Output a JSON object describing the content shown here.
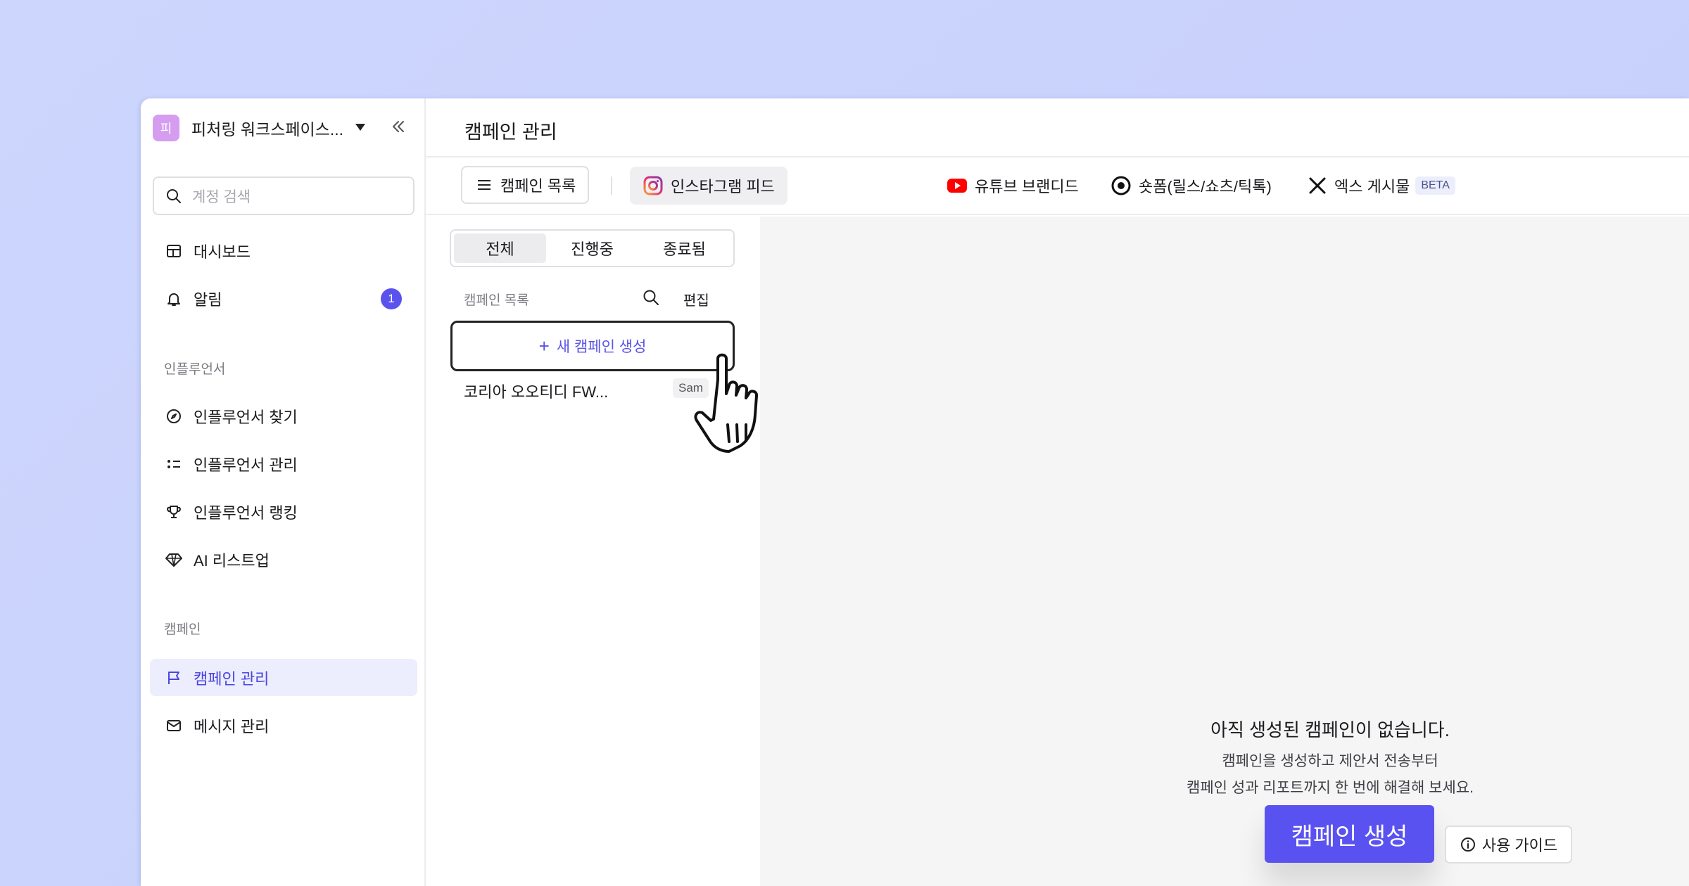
{
  "workspace": {
    "avatar_letter": "피",
    "name": "피처링 워크스페이스..."
  },
  "sidebar": {
    "search_placeholder": "계정 검색",
    "items": [
      {
        "label": "대시보드",
        "icon": "dashboard-icon"
      },
      {
        "label": "알림",
        "icon": "bell-icon",
        "badge": "1"
      }
    ],
    "influencer_section": "인플루언서",
    "influencer_items": [
      {
        "label": "인플루언서 찾기",
        "icon": "compass-icon"
      },
      {
        "label": "인플루언서 관리",
        "icon": "list-icon"
      },
      {
        "label": "인플루언서 랭킹",
        "icon": "trophy-icon"
      },
      {
        "label": "AI 리스트업",
        "icon": "diamond-icon"
      }
    ],
    "campaign_section": "캠페인",
    "campaign_items": [
      {
        "label": "캠페인 관리",
        "icon": "flag-icon",
        "active": true
      },
      {
        "label": "메시지 관리",
        "icon": "mail-icon"
      }
    ]
  },
  "header": {
    "title": "캠페인 관리"
  },
  "toolbar": {
    "list_button": "캠페인 목록",
    "channels": [
      {
        "label": "인스타그램 피드",
        "icon": "instagram-icon",
        "active": true
      },
      {
        "label": "유튜브 브랜디드",
        "icon": "youtube-icon"
      },
      {
        "label": "숏폼(릴스/쇼츠/틱톡)",
        "icon": "shortform-icon"
      },
      {
        "label": "엑스 게시물",
        "icon": "x-icon",
        "badge": "BETA"
      }
    ]
  },
  "list": {
    "segments": [
      "전체",
      "진행중",
      "종료됨"
    ],
    "active_segment": "전체",
    "header": "캠페인 목록",
    "edit": "편집",
    "new_button": "새 캠페인 생성",
    "rows": [
      {
        "name": "코리아 오오티디 FW...",
        "tag": "Sam"
      }
    ]
  },
  "empty_state": {
    "title": "아직 생성된 캠페인이 없습니다.",
    "desc_line1": "캠페인을 생성하고 제안서 전송부터",
    "desc_line2": "캠페인 성과 리포트까지 한 번에 해결해 보세요.",
    "create_button": "캠페인 생성",
    "guide_button": "사용 가이드"
  },
  "colors": {
    "accent": "#5a52f0",
    "active_bg": "#ecedfd",
    "avatar": "#d59cf0"
  }
}
